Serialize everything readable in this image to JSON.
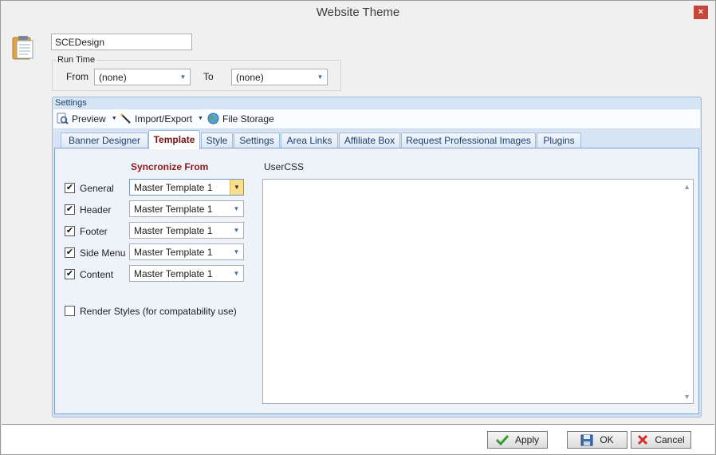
{
  "window": {
    "title": "Website Theme",
    "close_label": "×"
  },
  "name_field": {
    "value": "SCEDesign"
  },
  "run_time": {
    "legend": "Run Time",
    "from_label": "From",
    "from_value": "(none)",
    "to_label": "To",
    "to_value": "(none)"
  },
  "settings": {
    "title": "Settings",
    "toolbar": {
      "preview": "Preview",
      "import_export": "Import/Export",
      "file_storage": "File Storage"
    },
    "tabs": [
      "Banner Designer",
      "Template",
      "Style",
      "Settings",
      "Area Links",
      "Affiliate Box",
      "Request Professional Images",
      "Plugins"
    ],
    "selected_tab": "Template",
    "template": {
      "sync_title": "Syncronize From",
      "usercss_label": "UserCSS",
      "rows": [
        {
          "label": "General",
          "checked": true,
          "value": "Master Template 1"
        },
        {
          "label": "Header",
          "checked": true,
          "value": "Master Template 1"
        },
        {
          "label": "Footer",
          "checked": true,
          "value": "Master Template 1"
        },
        {
          "label": "Side Menu",
          "checked": true,
          "value": "Master Template 1"
        },
        {
          "label": "Content",
          "checked": true,
          "value": "Master Template 1"
        }
      ],
      "render_styles": {
        "label": "Render Styles (for compatability use)",
        "checked": false
      },
      "usercss_value": ""
    }
  },
  "buttons": {
    "apply": "Apply",
    "ok": "OK",
    "cancel": "Cancel"
  },
  "colors": {
    "accent_tab_text": "#7a1010",
    "sync_title": "#8b1a1a",
    "panel": "#d6e4f3"
  },
  "icons": {
    "app": "clipboard-icon",
    "preview": "preview-icon",
    "import_export": "wand-icon",
    "file_storage": "globe-icon",
    "apply": "check-icon",
    "ok": "save-icon",
    "cancel": "cancel-icon"
  }
}
